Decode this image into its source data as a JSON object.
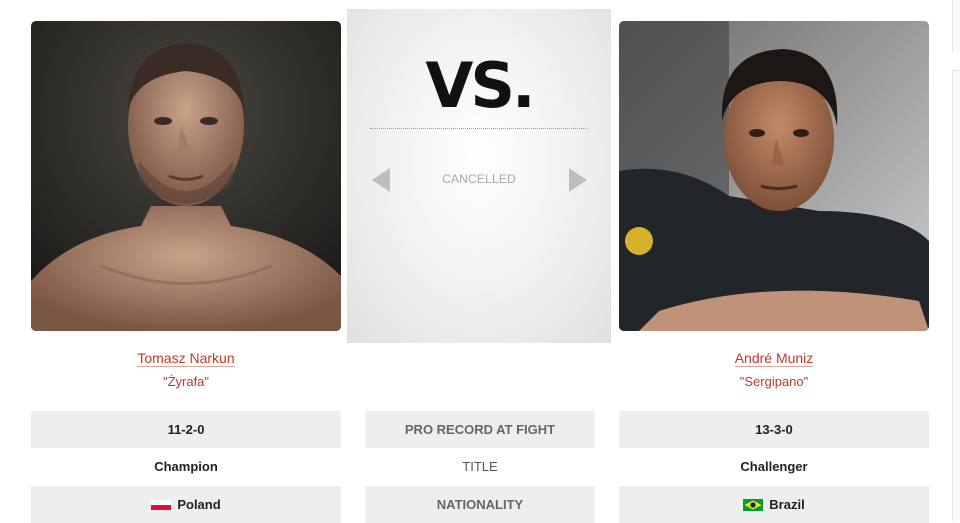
{
  "center": {
    "vs_label": "VS.",
    "status": "CANCELLED"
  },
  "fighters": {
    "left": {
      "name": "Tomasz Narkun",
      "nickname": "\"Żyrafa\"",
      "record": "11-2-0",
      "title": "Champion",
      "nationality": "Poland",
      "flag_colors": [
        "#ffffff",
        "#dc143c"
      ]
    },
    "right": {
      "name": "André Muniz",
      "nickname": "\"Sergipano\"",
      "record": "13-3-0",
      "title": "Challenger",
      "nationality": "Brazil",
      "flag_colors": [
        "#009c3b",
        "#ffdf00",
        "#002776"
      ]
    }
  },
  "stats_labels": {
    "record": "PRO RECORD AT FIGHT",
    "title": "TITLE",
    "nationality": "NATIONALITY"
  },
  "colors": {
    "accent": "#c0392b",
    "row_shade": "#eeeeee"
  },
  "icons": {
    "prev": "triangle-left-icon",
    "next": "triangle-right-icon"
  }
}
